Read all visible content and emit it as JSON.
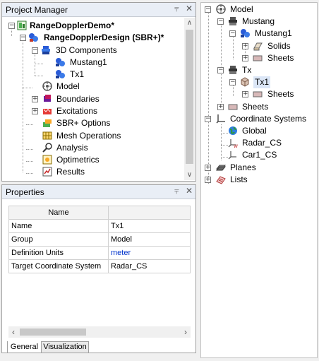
{
  "project_manager": {
    "title": "Project Manager",
    "pin_icon": "pin-icon",
    "close_icon": "close-icon",
    "tree": [
      {
        "label": "RangeDopplerDemo*",
        "icon": "project-icon",
        "bold": true
      },
      {
        "label": "RangeDopplerDesign (SBR+)*",
        "icon": "design-icon",
        "bold": true
      },
      {
        "label": "3D Components",
        "icon": "components-icon"
      },
      {
        "label": "Mustang1",
        "icon": "component-icon"
      },
      {
        "label": "Tx1",
        "icon": "component-icon"
      },
      {
        "label": "Model",
        "icon": "model-icon"
      },
      {
        "label": "Boundaries",
        "icon": "boundaries-icon"
      },
      {
        "label": "Excitations",
        "icon": "excitations-icon"
      },
      {
        "label": "SBR+ Options",
        "icon": "sbr-options-icon"
      },
      {
        "label": "Mesh Operations",
        "icon": "mesh-icon"
      },
      {
        "label": "Analysis",
        "icon": "analysis-icon"
      },
      {
        "label": "Optimetrics",
        "icon": "optimetrics-icon"
      },
      {
        "label": "Results",
        "icon": "results-icon"
      }
    ]
  },
  "properties": {
    "title": "Properties",
    "headers": [
      "Name",
      ""
    ],
    "rows": [
      {
        "name": "Name",
        "value": "Tx1"
      },
      {
        "name": "Group",
        "value": "Model"
      },
      {
        "name": "Definition Units",
        "value": "meter",
        "accent": "#0033cc"
      },
      {
        "name": "Target Coordinate System",
        "value": "Radar_CS"
      }
    ],
    "tabs": [
      "General",
      "Visualization"
    ]
  },
  "model_tree": {
    "items": [
      {
        "label": "Model",
        "icon": "model-icon"
      },
      {
        "label": "Mustang",
        "icon": "group-icon"
      },
      {
        "label": "Mustang1",
        "icon": "component-icon"
      },
      {
        "label": "Solids",
        "icon": "solids-icon"
      },
      {
        "label": "Sheets",
        "icon": "sheets-icon"
      },
      {
        "label": "Tx",
        "icon": "group-icon"
      },
      {
        "label": "Tx1",
        "icon": "component-icon"
      },
      {
        "label": "Sheets",
        "icon": "sheets-icon"
      },
      {
        "label": "Sheets",
        "icon": "sheets-icon"
      },
      {
        "label": "Coordinate Systems",
        "icon": "coordinate-systems-icon"
      },
      {
        "label": "Global",
        "icon": "globe-icon"
      },
      {
        "label": "Radar_CS",
        "icon": "cs-icon"
      },
      {
        "label": "Car1_CS",
        "icon": "cs-icon"
      },
      {
        "label": "Planes",
        "icon": "planes-icon"
      },
      {
        "label": "Lists",
        "icon": "lists-icon"
      }
    ]
  }
}
